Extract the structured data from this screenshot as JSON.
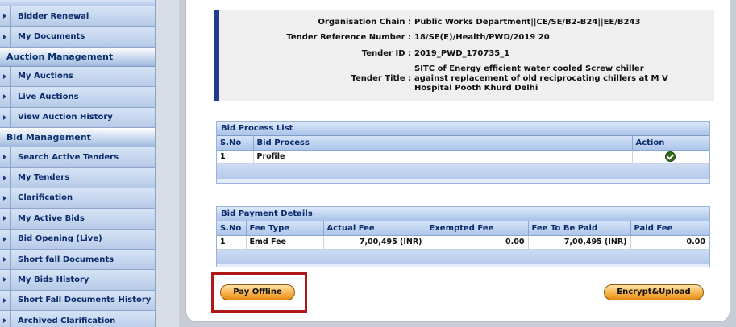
{
  "sidebar": {
    "items_top": [
      {
        "label": "Bidder Renewal"
      },
      {
        "label": "My Documents"
      }
    ],
    "auction_header": "Auction Management",
    "auction_items": [
      {
        "label": "My Auctions"
      },
      {
        "label": "Live Auctions"
      },
      {
        "label": "View Auction History"
      }
    ],
    "bid_header": "Bid Management",
    "bid_items": [
      {
        "label": "Search Active Tenders"
      },
      {
        "label": "My Tenders"
      },
      {
        "label": "Clarification"
      },
      {
        "label": "My Active Bids"
      },
      {
        "label": "Bid Opening (Live)"
      },
      {
        "label": "Short fall Documents"
      },
      {
        "label": "My Bids History"
      },
      {
        "label": "Short Fall Documents History"
      },
      {
        "label": "Archived Clarification"
      }
    ]
  },
  "tender_info": {
    "org_chain_label": "Organisation Chain :",
    "org_chain_value": "Public Works Department||CE/SE/B2-B24||EE/B243",
    "ref_label": "Tender Reference Number :",
    "ref_value": "18/SE(E)/Health/PWD/2019 20",
    "id_label": "Tender ID :",
    "id_value": "2019_PWD_170735_1",
    "title_label": "Tender Title :",
    "title_value": "SITC of Energy efficient water cooled Screw chiller against replacement of old reciprocating chillers at M V Hospital Pooth Khurd Delhi"
  },
  "bid_process": {
    "title": "Bid Process List",
    "headers": {
      "sno": "S.No",
      "process": "Bid Process",
      "action": "Action"
    },
    "rows": [
      {
        "sno": "1",
        "process": "Profile"
      }
    ]
  },
  "bid_payment": {
    "title": "Bid Payment Details",
    "headers": {
      "sno": "S.No",
      "fee_type": "Fee Type",
      "actual": "Actual Fee",
      "exempted": "Exempted Fee",
      "to_pay": "Fee To Be Paid",
      "paid": "Paid Fee"
    },
    "rows": [
      {
        "sno": "1",
        "fee_type": "Emd Fee",
        "actual": "7,00,495 (INR)",
        "exempted": "0.00",
        "to_pay": "7,00,495 (INR)",
        "paid": "0.00"
      }
    ]
  },
  "buttons": {
    "pay_offline": "Pay Offline",
    "encrypt_upload": "Encrypt&Upload"
  }
}
